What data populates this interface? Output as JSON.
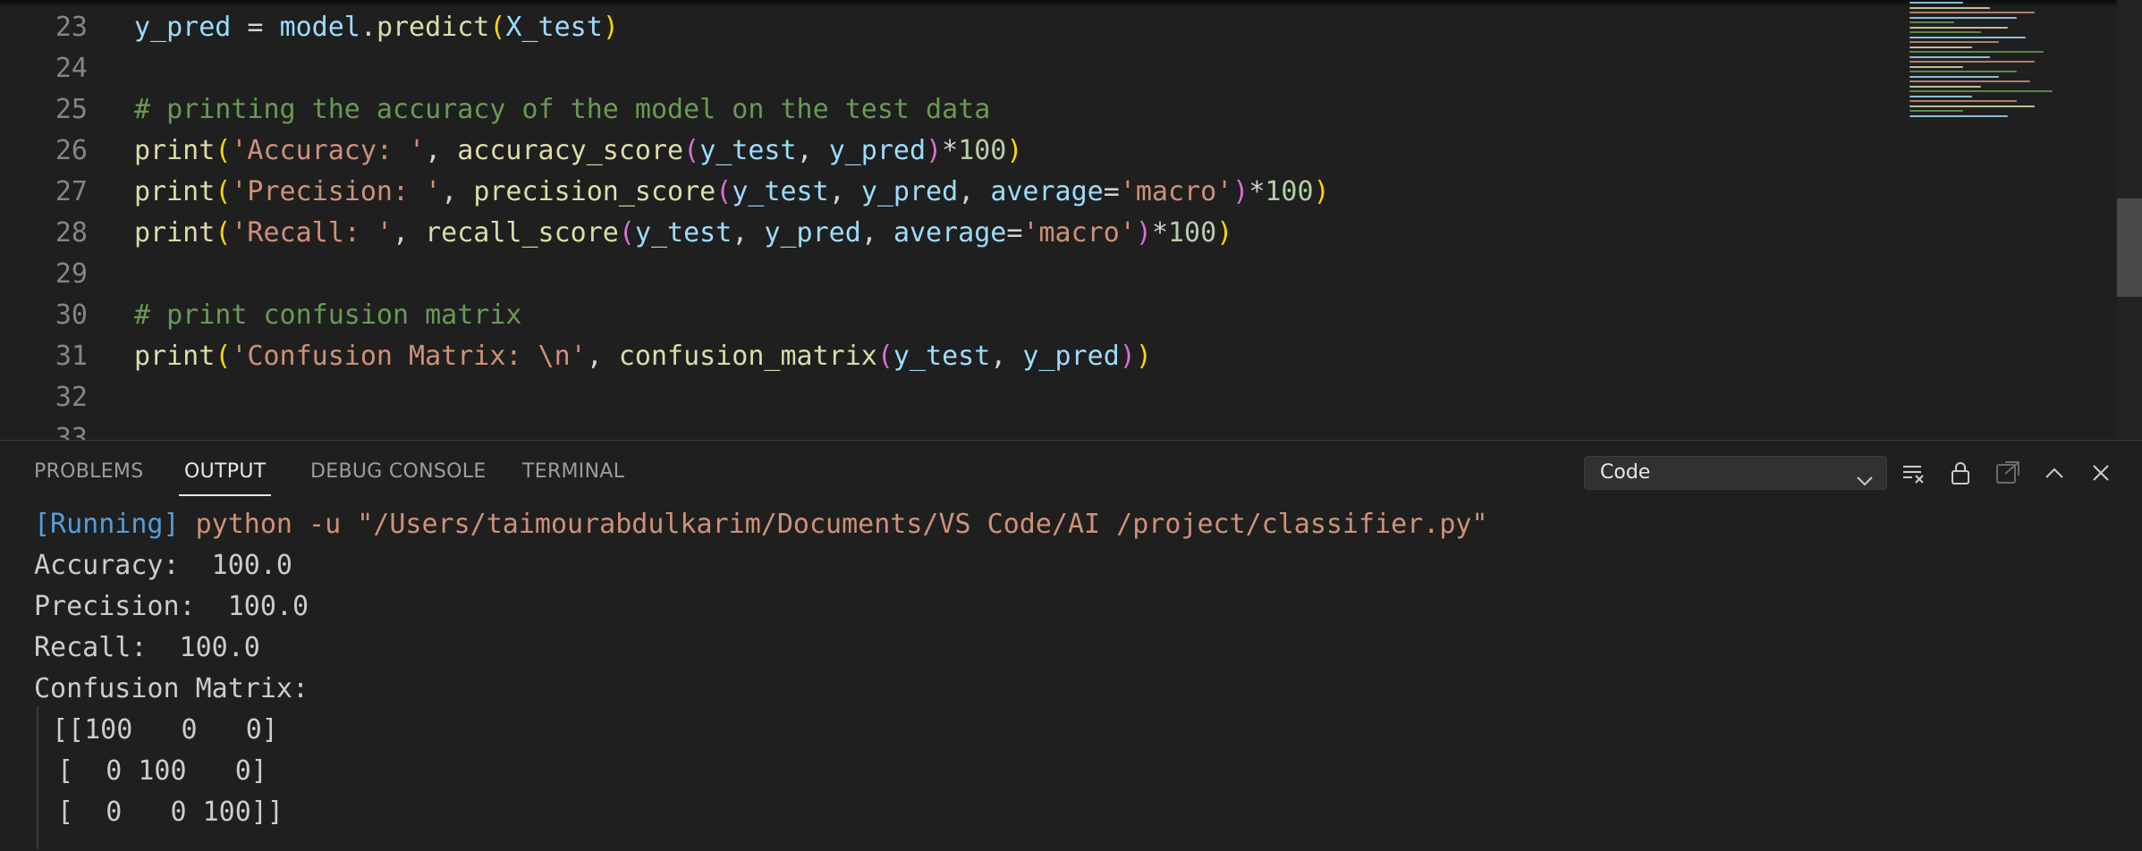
{
  "editor": {
    "lines": [
      {
        "num": "23",
        "tokens": [
          {
            "t": "y_pred",
            "c": "t-var"
          },
          {
            "t": " = ",
            "c": "t-txt"
          },
          {
            "t": "model",
            "c": "t-var"
          },
          {
            "t": ".",
            "c": "t-txt"
          },
          {
            "t": "predict",
            "c": "t-fn"
          },
          {
            "t": "(",
            "c": "t-p1"
          },
          {
            "t": "X_test",
            "c": "t-var"
          },
          {
            "t": ")",
            "c": "t-p1"
          }
        ]
      },
      {
        "num": "24",
        "tokens": []
      },
      {
        "num": "25",
        "tokens": [
          {
            "t": "# printing the accuracy of the model on the test data",
            "c": "t-com"
          }
        ]
      },
      {
        "num": "26",
        "tokens": [
          {
            "t": "print",
            "c": "t-fn"
          },
          {
            "t": "(",
            "c": "t-p1"
          },
          {
            "t": "'Accuracy: '",
            "c": "t-str"
          },
          {
            "t": ", ",
            "c": "t-txt"
          },
          {
            "t": "accuracy_score",
            "c": "t-fn"
          },
          {
            "t": "(",
            "c": "t-p2"
          },
          {
            "t": "y_test",
            "c": "t-var"
          },
          {
            "t": ", ",
            "c": "t-txt"
          },
          {
            "t": "y_pred",
            "c": "t-var"
          },
          {
            "t": ")",
            "c": "t-p2"
          },
          {
            "t": "*",
            "c": "t-txt"
          },
          {
            "t": "100",
            "c": "t-num"
          },
          {
            "t": ")",
            "c": "t-p1"
          }
        ]
      },
      {
        "num": "27",
        "tokens": [
          {
            "t": "print",
            "c": "t-fn"
          },
          {
            "t": "(",
            "c": "t-p1"
          },
          {
            "t": "'Precision: '",
            "c": "t-str"
          },
          {
            "t": ", ",
            "c": "t-txt"
          },
          {
            "t": "precision_score",
            "c": "t-fn"
          },
          {
            "t": "(",
            "c": "t-p2"
          },
          {
            "t": "y_test",
            "c": "t-var"
          },
          {
            "t": ", ",
            "c": "t-txt"
          },
          {
            "t": "y_pred",
            "c": "t-var"
          },
          {
            "t": ", ",
            "c": "t-txt"
          },
          {
            "t": "average",
            "c": "t-var"
          },
          {
            "t": "=",
            "c": "t-txt"
          },
          {
            "t": "'macro'",
            "c": "t-str"
          },
          {
            "t": ")",
            "c": "t-p2"
          },
          {
            "t": "*",
            "c": "t-txt"
          },
          {
            "t": "100",
            "c": "t-num"
          },
          {
            "t": ")",
            "c": "t-p1"
          }
        ]
      },
      {
        "num": "28",
        "tokens": [
          {
            "t": "print",
            "c": "t-fn"
          },
          {
            "t": "(",
            "c": "t-p1"
          },
          {
            "t": "'Recall: '",
            "c": "t-str"
          },
          {
            "t": ", ",
            "c": "t-txt"
          },
          {
            "t": "recall_score",
            "c": "t-fn"
          },
          {
            "t": "(",
            "c": "t-p2"
          },
          {
            "t": "y_test",
            "c": "t-var"
          },
          {
            "t": ", ",
            "c": "t-txt"
          },
          {
            "t": "y_pred",
            "c": "t-var"
          },
          {
            "t": ", ",
            "c": "t-txt"
          },
          {
            "t": "average",
            "c": "t-var"
          },
          {
            "t": "=",
            "c": "t-txt"
          },
          {
            "t": "'macro'",
            "c": "t-str"
          },
          {
            "t": ")",
            "c": "t-p2"
          },
          {
            "t": "*",
            "c": "t-txt"
          },
          {
            "t": "100",
            "c": "t-num"
          },
          {
            "t": ")",
            "c": "t-p1"
          }
        ]
      },
      {
        "num": "29",
        "tokens": []
      },
      {
        "num": "30",
        "tokens": [
          {
            "t": "# print confusion matrix",
            "c": "t-com"
          }
        ]
      },
      {
        "num": "31",
        "tokens": [
          {
            "t": "print",
            "c": "t-fn"
          },
          {
            "t": "(",
            "c": "t-p1"
          },
          {
            "t": "'Confusion Matrix: \\n'",
            "c": "t-str"
          },
          {
            "t": ", ",
            "c": "t-txt"
          },
          {
            "t": "confusion_matrix",
            "c": "t-fn"
          },
          {
            "t": "(",
            "c": "t-p2"
          },
          {
            "t": "y_test",
            "c": "t-var"
          },
          {
            "t": ", ",
            "c": "t-txt"
          },
          {
            "t": "y_pred",
            "c": "t-var"
          },
          {
            "t": ")",
            "c": "t-p2"
          },
          {
            "t": ")",
            "c": "t-p1"
          }
        ]
      },
      {
        "num": "32",
        "tokens": []
      },
      {
        "num": "33",
        "tokens": []
      }
    ]
  },
  "panel": {
    "tabs": [
      "PROBLEMS",
      "OUTPUT",
      "DEBUG CONSOLE",
      "TERMINAL"
    ],
    "active_tab": "OUTPUT",
    "channel": "Code",
    "output": {
      "running_tag": "[Running]",
      "command": "python -u \"/Users/taimourabdulkarim/Documents/VS Code/AI /project/classifier.py\"",
      "lines": [
        "Accuracy:  100.0",
        "Precision:  100.0",
        "Recall:  100.0",
        "Confusion Matrix:"
      ],
      "matrix": [
        "[[100   0   0]",
        " [  0 100   0]",
        " [  0   0 100]]"
      ]
    }
  },
  "icons": [
    "clear-output-icon",
    "lock-icon",
    "open-in-editor-icon",
    "maximize-panel-icon",
    "close-panel-icon",
    "chevron-down-icon"
  ],
  "colors": {
    "accent_blue": "#569cd6",
    "string": "#ce9178",
    "function": "#dcdcaa",
    "comment": "#6a9955"
  }
}
